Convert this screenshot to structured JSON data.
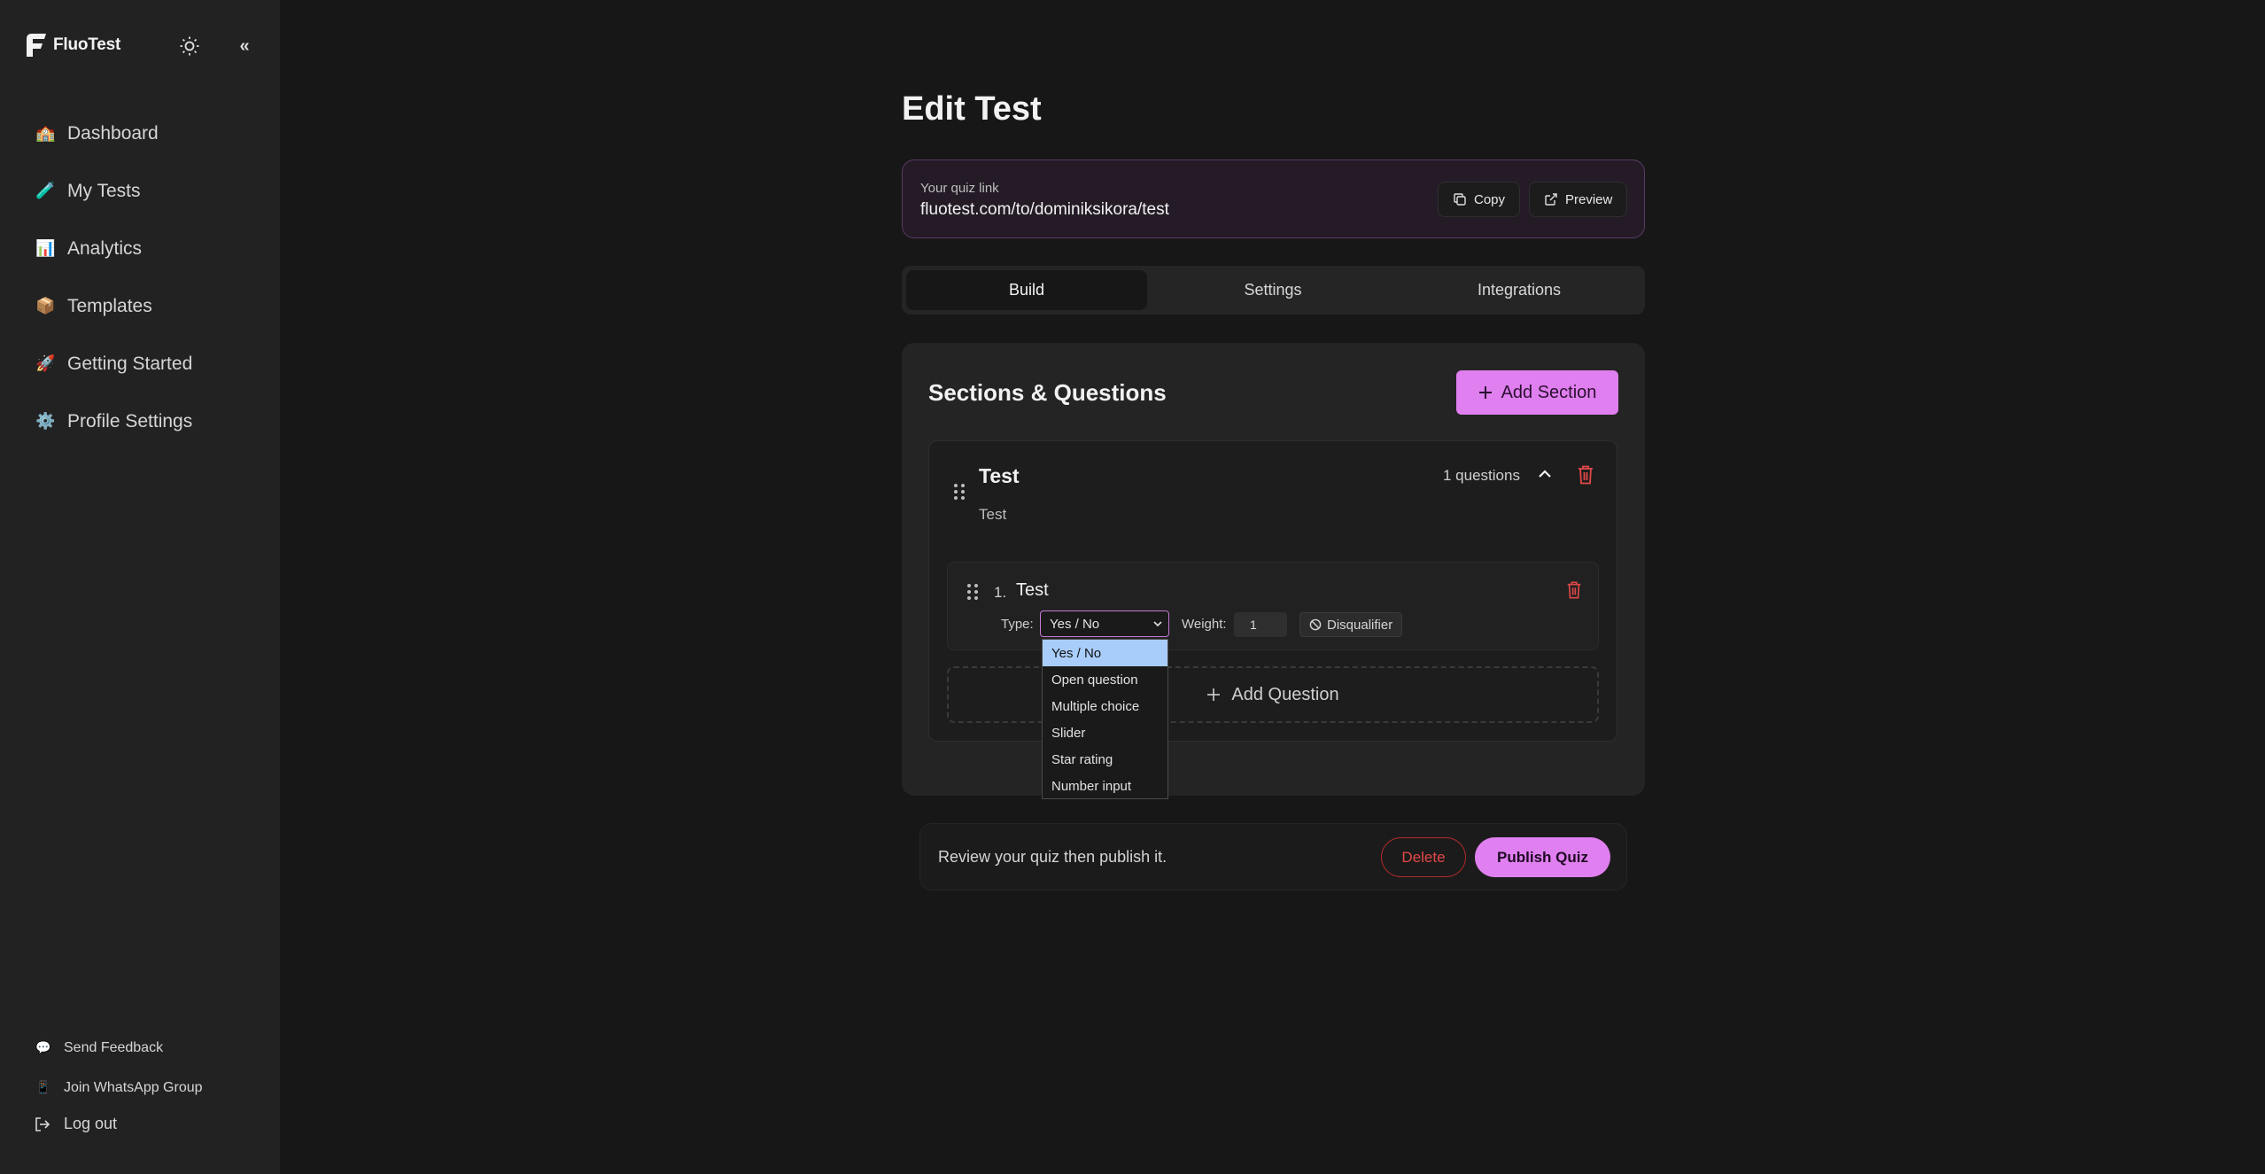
{
  "app": {
    "name": "FluoTest"
  },
  "sidebar": {
    "items": [
      {
        "emoji": "🏫",
        "label": "Dashboard"
      },
      {
        "emoji": "🧪",
        "label": "My Tests"
      },
      {
        "emoji": "📊",
        "label": "Analytics"
      },
      {
        "emoji": "📦",
        "label": "Templates"
      },
      {
        "emoji": "🚀",
        "label": "Getting Started"
      },
      {
        "emoji": "⚙️",
        "label": "Profile Settings"
      }
    ],
    "footer": [
      {
        "emoji": "💬",
        "label": "Send Feedback"
      },
      {
        "emoji": "📱",
        "label": "Join WhatsApp Group"
      }
    ],
    "logout_label": "Log out",
    "collapse_glyph": "«"
  },
  "main": {
    "title": "Edit Test",
    "link": {
      "caption": "Your quiz link",
      "url": "fluotest.com/to/dominiksikora/test",
      "copy_label": "Copy",
      "preview_label": "Preview"
    },
    "tabs": [
      {
        "label": "Build",
        "active": true
      },
      {
        "label": "Settings",
        "active": false
      },
      {
        "label": "Integrations",
        "active": false
      }
    ],
    "sections_panel": {
      "title": "Sections & Questions",
      "add_section_label": "Add Section",
      "section": {
        "title": "Test",
        "description": "Test",
        "count_label": "1 questions",
        "question": {
          "number": "1.",
          "title": "Test",
          "type_label": "Type:",
          "type_value": "Yes / No",
          "weight_label": "Weight:",
          "weight_value": "1",
          "disqualifier_label": "Disqualifier"
        },
        "add_question_label": "Add Question"
      }
    },
    "type_dropdown": {
      "options": [
        "Yes / No",
        "Open question",
        "Multiple choice",
        "Slider",
        "Star rating",
        "Number input"
      ],
      "selected_index": 0
    },
    "publish_bar": {
      "message": "Review your quiz then publish it.",
      "delete_label": "Delete",
      "publish_label": "Publish Quiz"
    }
  },
  "colors": {
    "accent": "#e07fef",
    "danger": "#e24848",
    "background": "#171717",
    "sidebar": "#222222"
  }
}
